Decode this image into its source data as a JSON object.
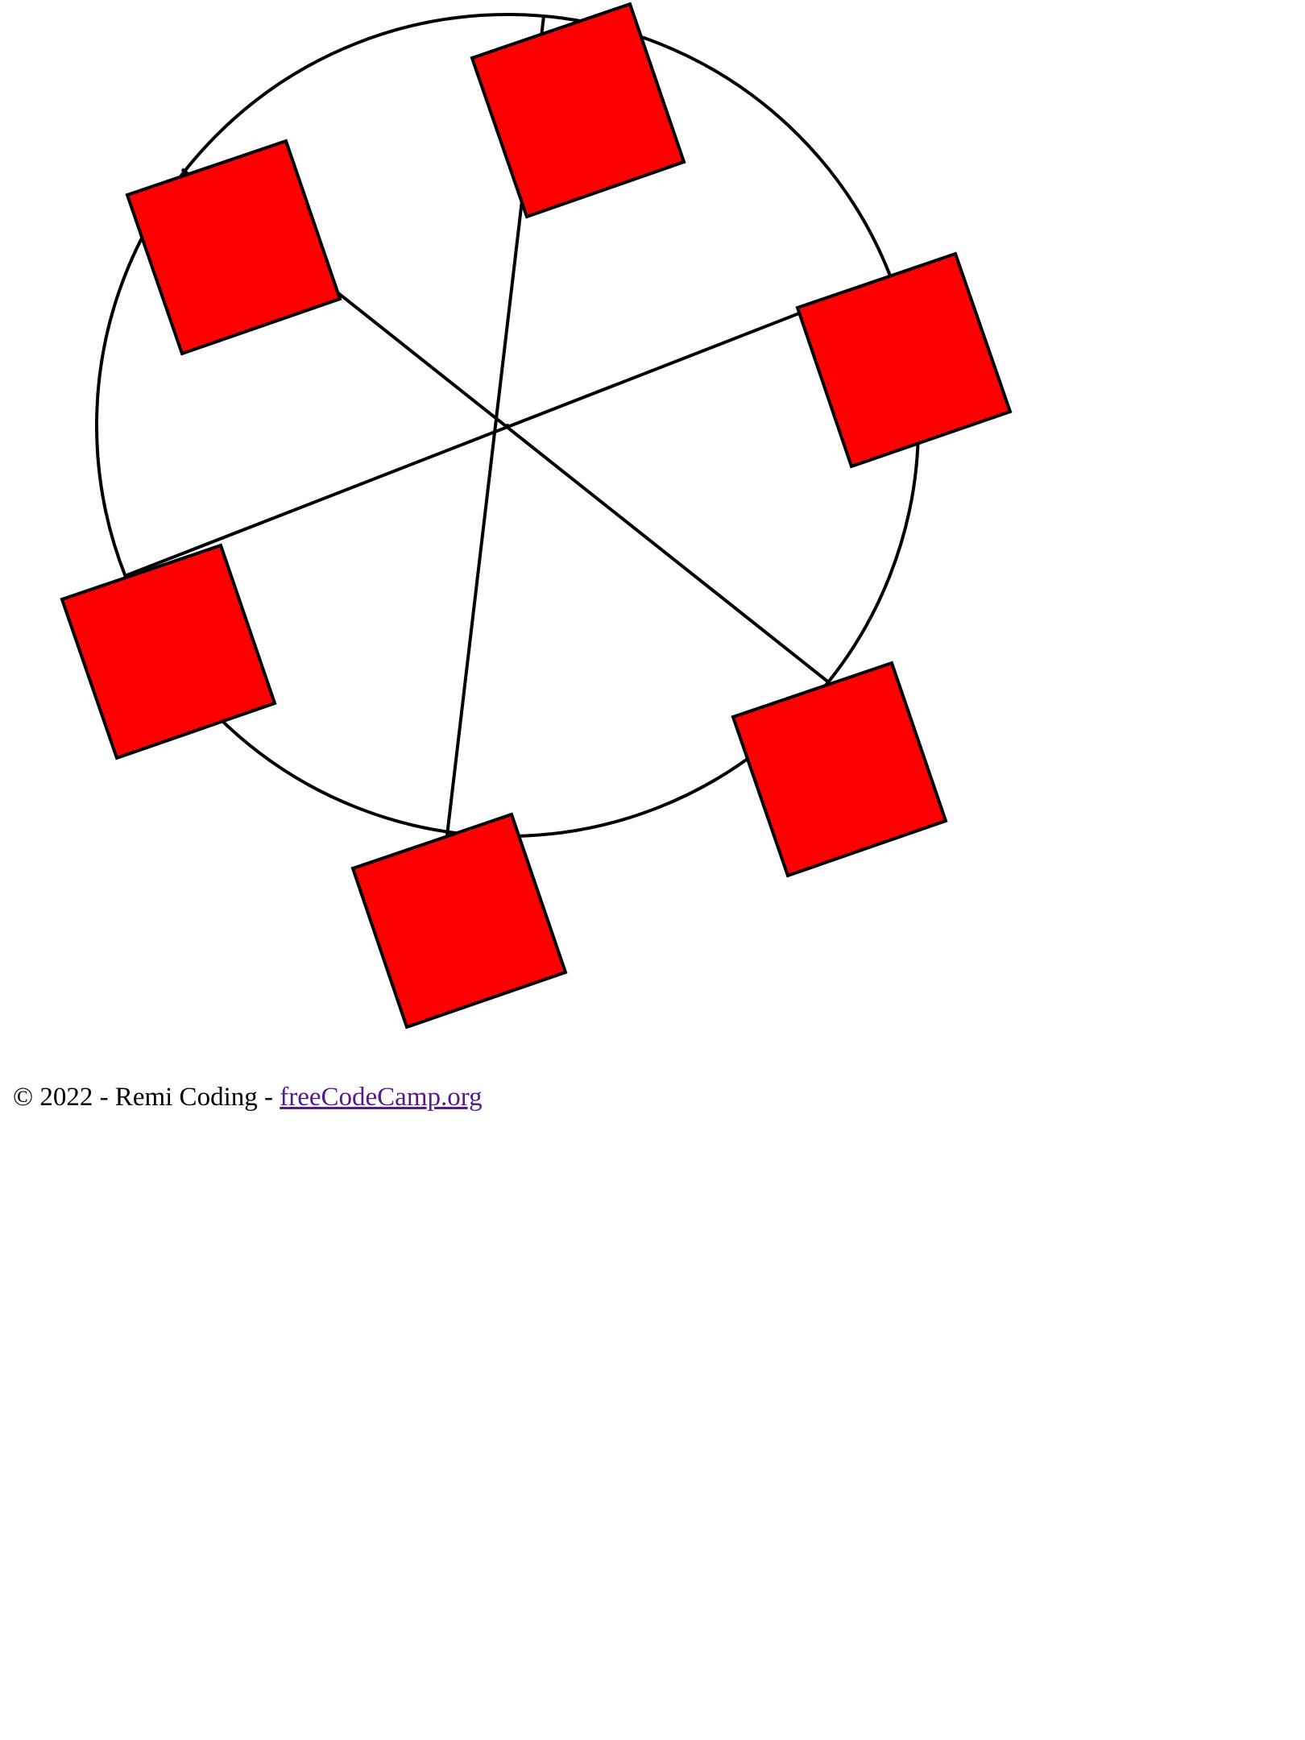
{
  "ferris_wheel": {
    "cabin_count": 6,
    "cabin_color": "#ff0000",
    "stroke_color": "#000000",
    "background_color": "#ffffff"
  },
  "footer": {
    "copyright": "© 2022 - Remi Coding - ",
    "link_text": "freeCodeCamp.org",
    "link_color": "#551a8b"
  }
}
